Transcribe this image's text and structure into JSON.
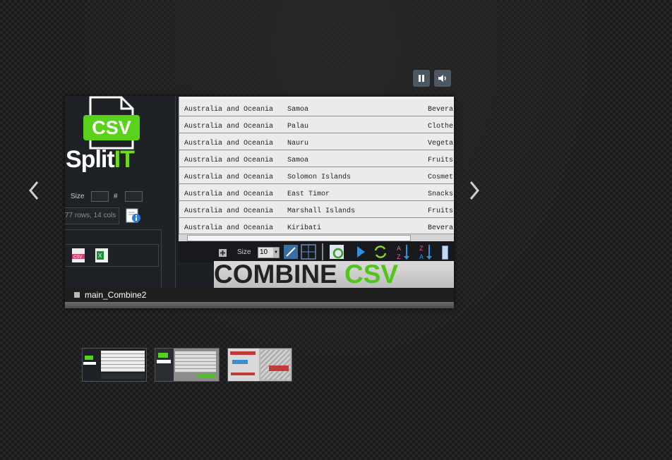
{
  "controls": {
    "pause_icon": "pause-icon",
    "volume_icon": "volume-icon"
  },
  "slide": {
    "logo": {
      "csv": "CSV",
      "split": "Split",
      "it": "IT"
    },
    "size_label": "Size",
    "hash_label": "#",
    "rows_info": "77 rows, 14 cols",
    "table_rows": [
      {
        "region": "Australia and Oceania",
        "country": "Samoa",
        "type": "Bevera"
      },
      {
        "region": "Australia and Oceania",
        "country": "Palau",
        "type": "Clothe"
      },
      {
        "region": "Australia and Oceania",
        "country": "Nauru",
        "type": "Vegeta"
      },
      {
        "region": "Australia and Oceania",
        "country": "Samoa",
        "type": "Fruits"
      },
      {
        "region": "Australia and Oceania",
        "country": "Solomon Islands",
        "type": "Cosmet"
      },
      {
        "region": "Australia and Oceania",
        "country": "East Timor",
        "type": "Snacks"
      },
      {
        "region": "Australia and Oceania",
        "country": "Marshall Islands",
        "type": "Fruits"
      },
      {
        "region": "Australia and Oceania",
        "country": "Kiribati",
        "type": "Bevera"
      }
    ],
    "toolbar": {
      "size_label": "Size",
      "size_value": "10"
    },
    "combine": {
      "word1": "COMBINE",
      "word2": "CSV"
    },
    "caption": "main_Combine2"
  },
  "colors": {
    "accent_green": "#58d21b",
    "control_bg": "#4d5864"
  }
}
